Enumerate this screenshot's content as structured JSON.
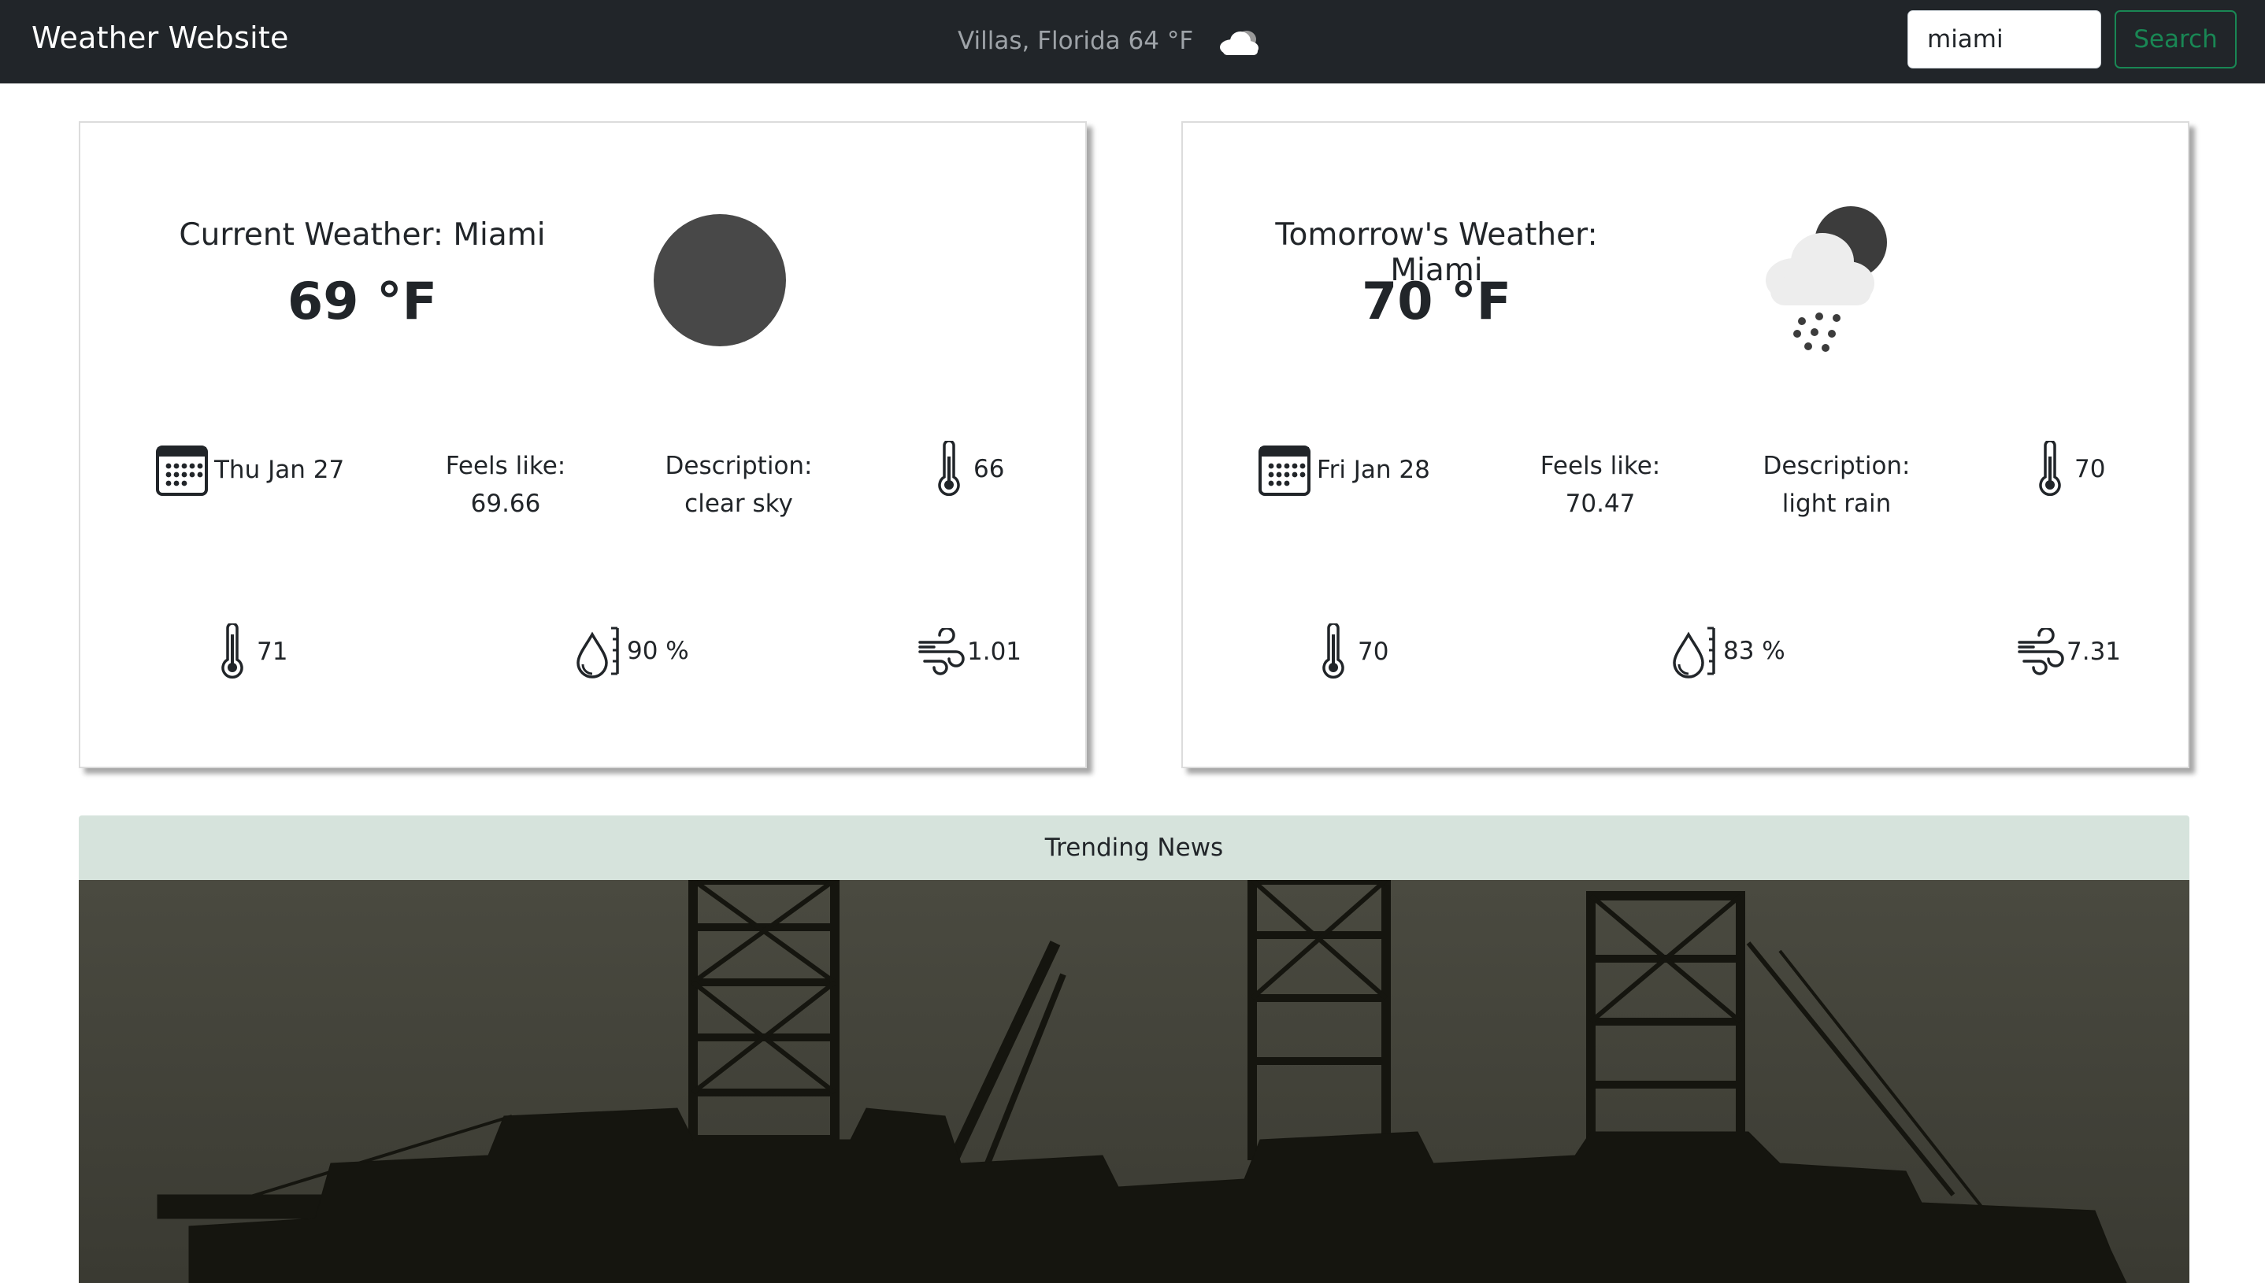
{
  "navbar": {
    "brand": "Weather Website",
    "location_weather": "Villas, Florida 64 °F",
    "location_icon": "cloud-icon",
    "search_value": "miami",
    "search_label": "Search",
    "search_color": "#198754"
  },
  "current": {
    "title": "Current Weather: Miami",
    "temp": "69 °F",
    "icon": "clear-sky-circle-icon",
    "date": "Thu Jan 27",
    "feels_label": "Feels like:",
    "feels_value": "69.66",
    "desc_label": "Description:",
    "desc_value": "clear sky",
    "temp_min": "66",
    "temp_max": "71",
    "humidity": "90 %",
    "wind": "1.01"
  },
  "tomorrow": {
    "title": "Tomorrow's Weather: Miami",
    "temp": "70 °F",
    "icon": "rain-cloud-night-icon",
    "date": "Fri Jan 28",
    "feels_label": "Feels like:",
    "feels_value": "70.47",
    "desc_label": "Description:",
    "desc_value": "light rain",
    "temp_min": "70",
    "temp_max": "70",
    "humidity": "83 %",
    "wind": "7.31"
  },
  "news": {
    "header": "Trending News",
    "header_bg": "#d6e3dc",
    "image_subject": "offshore oil rigs silhouette"
  }
}
